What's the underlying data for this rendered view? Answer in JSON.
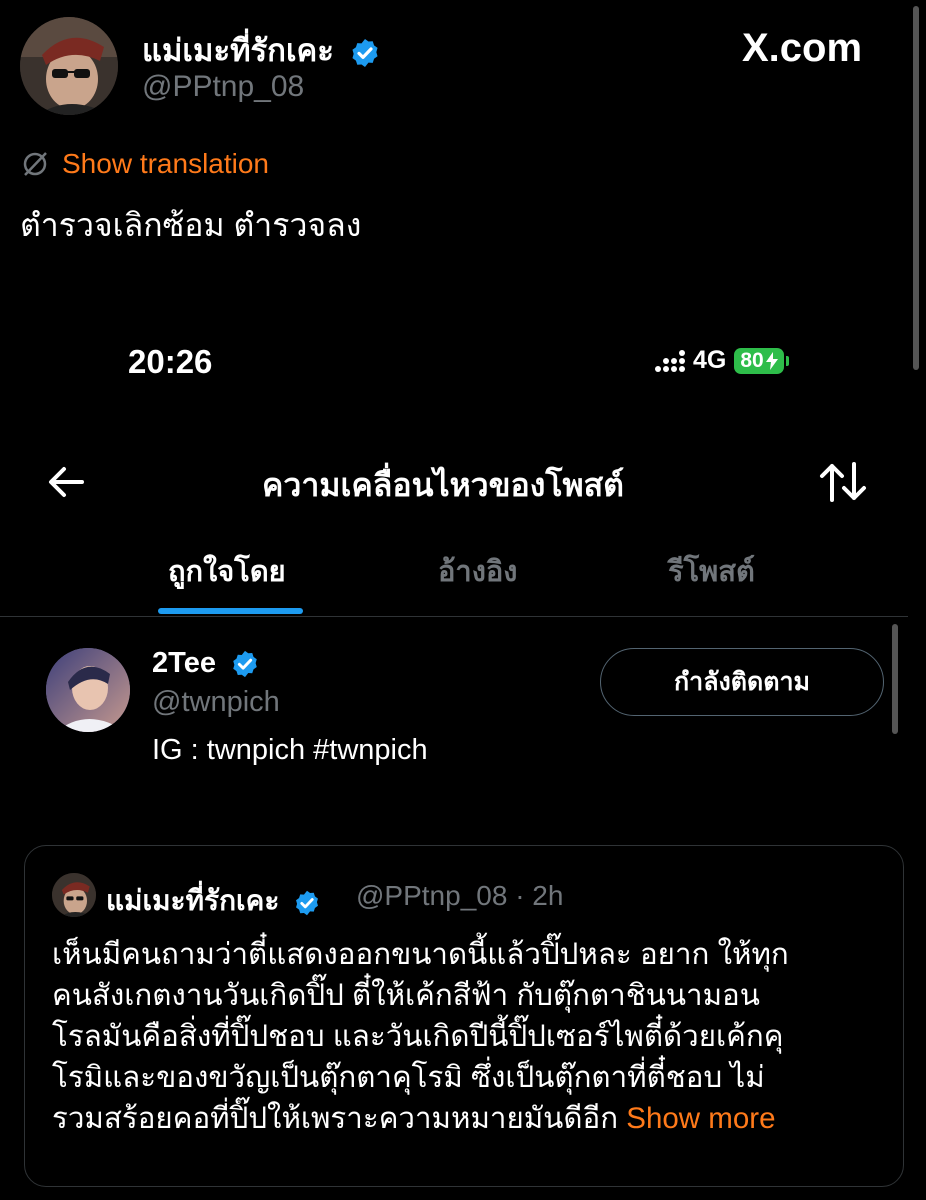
{
  "post": {
    "author_name": "แม่เมะที่รักเคะ",
    "author_handle": "@PPtnp_08",
    "brand": "X.com",
    "translate_label": "Show translation",
    "text": "ตำรวจเลิกซ้อม ตำรวจลง"
  },
  "status_bar": {
    "time": "20:26",
    "network": "4G",
    "battery": "80"
  },
  "nav": {
    "title": "ความเคลื่อนไหวของโพสต์"
  },
  "tabs": [
    {
      "label": "ถูกใจโดย",
      "active": true
    },
    {
      "label": "อ้างอิง",
      "active": false
    },
    {
      "label": "รีโพสต์",
      "active": false
    }
  ],
  "liker": {
    "name": "2Tee",
    "handle": "@twnpich",
    "bio": "IG : twnpich #twnpich",
    "follow_label": "กำลังติดตาม"
  },
  "quote": {
    "author_name": "แม่เมะที่รักเคะ",
    "meta": "@PPtnp_08 · 2h",
    "lines": [
      "เห็นมีคนถามว่าตี๋แสดงออกขนาดนี้แล้วปิ๊ปหละ อยาก ให้ทุก",
      "คนสังเกตงานวันเกิดปิ๊ป ตี๋ให้เค้กสีฟ้า กับตุ๊กตาชินนามอน",
      "โรลมันคือสิ่งที่ปิ๊ปชอบ และวันเกิดปีนี้ปิ๊ปเซอร์ไพตี๋ด้วยเค้กคุ",
      "โรมิและของขวัญเป็นตุ๊กตาคุโรมิ ซึ่งเป็นตุ๊กตาที่ตี๋ชอบ ไม่",
      "รวมสร้อยคอที่ปิ๊ปให้เพราะความหมายมันดีอีก"
    ],
    "show_more": "Show more"
  },
  "colors": {
    "background": "#000000",
    "verified_blue": "#1d9bf0",
    "accent_orange": "#ff7a1a",
    "battery_green": "#2ebd4a"
  },
  "icons": [
    "verified-badge-icon",
    "translate-icon",
    "back-arrow-icon",
    "sort-arrows-icon",
    "signal-icon"
  ]
}
